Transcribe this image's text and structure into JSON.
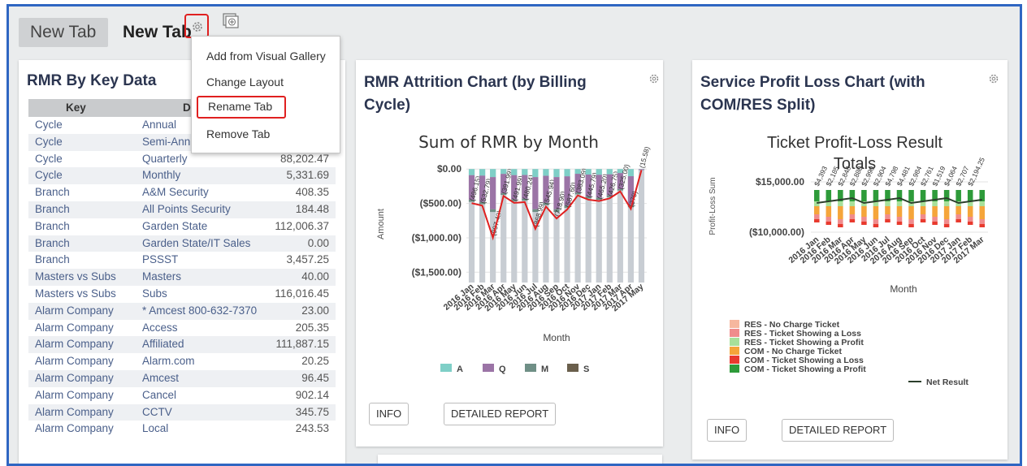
{
  "tabs": {
    "inactive": "New Tab",
    "active": "New Tab"
  },
  "menu": {
    "items": [
      "Add from Visual Gallery",
      "Change Layout",
      "Rename Tab",
      "Remove Tab"
    ]
  },
  "panels": {
    "rmr_key": {
      "title": "RMR By Key Data",
      "headers": [
        "Key",
        "Data"
      ],
      "rows": [
        [
          "Cycle",
          "Annual",
          ""
        ],
        [
          "Cycle",
          "Semi-Annual",
          ""
        ],
        [
          "Cycle",
          "Quarterly",
          "88,202.47"
        ],
        [
          "Cycle",
          "Monthly",
          "5,331.69"
        ],
        [
          "Branch",
          "A&M Security",
          "408.35"
        ],
        [
          "Branch",
          "All Points Security",
          "184.48"
        ],
        [
          "Branch",
          "Garden State",
          "112,006.37"
        ],
        [
          "Branch",
          "Garden State/IT Sales",
          "0.00"
        ],
        [
          "Branch",
          "PSSST",
          "3,457.25"
        ],
        [
          "Masters vs Subs",
          "Masters",
          "40.00"
        ],
        [
          "Masters vs Subs",
          "Subs",
          "116,016.45"
        ],
        [
          "Alarm Company",
          "* Amcest 800-632-7370",
          "23.00"
        ],
        [
          "Alarm Company",
          "Access",
          "205.35"
        ],
        [
          "Alarm Company",
          "Affiliated",
          "111,887.15"
        ],
        [
          "Alarm Company",
          "Alarm.com",
          "20.25"
        ],
        [
          "Alarm Company",
          "Amcest",
          "96.45"
        ],
        [
          "Alarm Company",
          "Cancel",
          "902.14"
        ],
        [
          "Alarm Company",
          "CCTV",
          "345.75"
        ],
        [
          "Alarm Company",
          "Local",
          "243.53"
        ]
      ]
    },
    "attrition": {
      "title_line1": "RMR Attrition Chart (by Billing",
      "title_line2": "Cycle)",
      "info": "INFO",
      "report": "DETAILED REPORT"
    },
    "profit": {
      "title_line1": "Service Profit Loss Chart (with",
      "title_line2": "COM/RES Split)",
      "info": "INFO",
      "report": "DETAILED REPORT"
    }
  },
  "chart_data": [
    {
      "type": "bar",
      "title": "Sum of RMR by Month",
      "xlabel": "Month",
      "ylabel": "Amount",
      "yticks": [
        "$0.00",
        "($500.00)",
        "($1,000.00)",
        "($1,500.00)"
      ],
      "ylim": [
        -1650,
        50
      ],
      "categories": [
        "2016 Jan",
        "2016 Feb",
        "2016 Mar",
        "2016 Apr",
        "2016 May",
        "2016 Jun",
        "2016 Jul",
        "2016 Aug",
        "2016 Sep",
        "2016 Oct",
        "2016 Nov",
        "2016 Dec",
        "2017 Jan",
        "2017 Feb",
        "2017 Mar",
        "2017 Apr",
        "2017 May"
      ],
      "line_values": [
        -496.15,
        -532,
        -997.43,
        -391,
        -491.99,
        -480,
        -868.99,
        -545.94,
        -718.9,
        -587.6,
        -383.09,
        -445,
        -465.2,
        -426.75,
        -325,
        -579,
        -15.58
      ],
      "data_labels": [
        "(496.15)",
        "(532.79)",
        "(997.43)",
        "(391.99)",
        "(491.99)",
        "(480.24)",
        "(868.99)",
        "(545.94)",
        "(718.90)",
        "(587.60)",
        "(383.09)",
        "(445.79)",
        "(465.20)",
        "(426.75)",
        "(325.00)",
        "(279)",
        "(15.58)"
      ],
      "legend": [
        "A",
        "Q",
        "M",
        "S"
      ],
      "colors": {
        "A": "#7fcfc7",
        "Q": "#9b74a6",
        "M": "#6f8f86",
        "S": "#6a5f4c",
        "line": "#e02020",
        "bar_bg": "#c8cdd3"
      }
    },
    {
      "type": "bar",
      "title": "Ticket Profit-Loss Result Totals",
      "xlabel": "Month",
      "ylabel": "Profit-Loss Sum",
      "yticks": [
        "$15,000.00",
        "($10,000.00)"
      ],
      "categories": [
        "2016 Jan",
        "2016 Feb",
        "2016 Mar",
        "2016 Apr",
        "2016 May",
        "2016 Jun",
        "2016 Jul",
        "2016 Aug",
        "2016 Sep",
        "2016 Oct",
        "2016 Nov",
        "2016 Dec",
        "2017 Jan",
        "2017 Feb",
        "2017 Mar"
      ],
      "data_labels": [
        "$4,393",
        "$2,185",
        "$2,848",
        "$2,880",
        "$2,990",
        "$2,904",
        "$4,798",
        "$4,481",
        "$2,984",
        "$2,761",
        "$1,519",
        "$4,064",
        "$2,707",
        "$2,194.25"
      ],
      "legend": [
        {
          "name": "RES - No Charge Ticket",
          "color": "#f6b79e"
        },
        {
          "name": "RES - Ticket Showing a Loss",
          "color": "#f08c8c"
        },
        {
          "name": "RES - Ticket Showing a Profit",
          "color": "#a8e09a"
        },
        {
          "name": "COM - No Charge Ticket",
          "color": "#f5a53a"
        },
        {
          "name": "COM - Ticket Showing a Loss",
          "color": "#e83a2e"
        },
        {
          "name": "COM - Ticket Showing a Profit",
          "color": "#2e9b3a"
        },
        {
          "name": "Net Result",
          "color": "#2b3e2b"
        }
      ]
    }
  ]
}
